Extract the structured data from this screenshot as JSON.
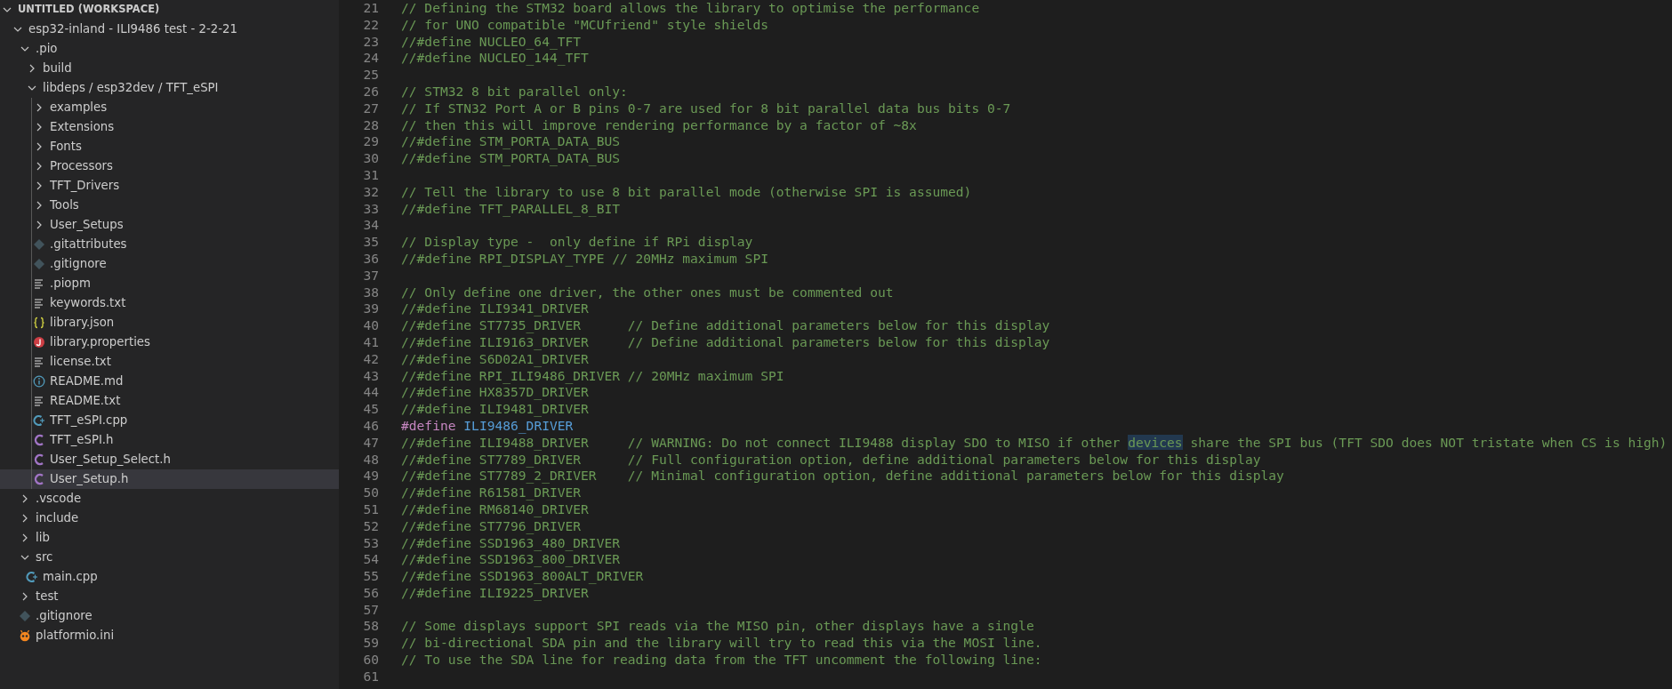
{
  "explorer": {
    "workspace": {
      "label": "UNTITLED (WORKSPACE)",
      "expanded": true
    },
    "tree": [
      {
        "label": "esp32-inland - ILI9486 test - 2-2-21",
        "kind": "folder",
        "expanded": true,
        "selected": false,
        "children": [
          {
            "label": ".pio",
            "kind": "folder",
            "expanded": true,
            "selected": false,
            "children": [
              {
                "label": "build",
                "kind": "folder",
                "expanded": false,
                "selected": false
              },
              {
                "label": "libdeps / esp32dev / TFT_eSPI",
                "kind": "folder",
                "expanded": true,
                "selected": false,
                "children": [
                  {
                    "label": "examples",
                    "kind": "folder",
                    "expanded": false,
                    "selected": false
                  },
                  {
                    "label": "Extensions",
                    "kind": "folder",
                    "expanded": false,
                    "selected": false
                  },
                  {
                    "label": "Fonts",
                    "kind": "folder",
                    "expanded": false,
                    "selected": false
                  },
                  {
                    "label": "Processors",
                    "kind": "folder",
                    "expanded": false,
                    "selected": false
                  },
                  {
                    "label": "TFT_Drivers",
                    "kind": "folder",
                    "expanded": false,
                    "selected": false
                  },
                  {
                    "label": "Tools",
                    "kind": "folder",
                    "expanded": false,
                    "selected": false
                  },
                  {
                    "label": "User_Setups",
                    "kind": "folder",
                    "expanded": false,
                    "selected": false
                  },
                  {
                    "label": ".gitattributes",
                    "kind": "git",
                    "selected": false
                  },
                  {
                    "label": ".gitignore",
                    "kind": "git",
                    "selected": false
                  },
                  {
                    "label": ".piopm",
                    "kind": "text",
                    "selected": false
                  },
                  {
                    "label": "keywords.txt",
                    "kind": "text",
                    "selected": false
                  },
                  {
                    "label": "library.json",
                    "kind": "json",
                    "selected": false
                  },
                  {
                    "label": "library.properties",
                    "kind": "properties",
                    "selected": false
                  },
                  {
                    "label": "license.txt",
                    "kind": "text",
                    "selected": false
                  },
                  {
                    "label": "README.md",
                    "kind": "info",
                    "selected": false
                  },
                  {
                    "label": "README.txt",
                    "kind": "text",
                    "selected": false
                  },
                  {
                    "label": "TFT_eSPI.cpp",
                    "kind": "cpp",
                    "selected": false
                  },
                  {
                    "label": "TFT_eSPI.h",
                    "kind": "c",
                    "selected": false
                  },
                  {
                    "label": "User_Setup_Select.h",
                    "kind": "c",
                    "selected": false
                  },
                  {
                    "label": "User_Setup.h",
                    "kind": "c",
                    "selected": true
                  }
                ]
              }
            ]
          },
          {
            "label": ".vscode",
            "kind": "folder",
            "expanded": false,
            "selected": false
          },
          {
            "label": "include",
            "kind": "folder",
            "expanded": false,
            "selected": false
          },
          {
            "label": "lib",
            "kind": "folder",
            "expanded": false,
            "selected": false
          },
          {
            "label": "src",
            "kind": "folder",
            "expanded": true,
            "selected": false,
            "children": [
              {
                "label": "main.cpp",
                "kind": "cpp",
                "selected": false
              }
            ]
          },
          {
            "label": "test",
            "kind": "folder",
            "expanded": false,
            "selected": false
          },
          {
            "label": ".gitignore",
            "kind": "git",
            "selected": false
          },
          {
            "label": "platformio.ini",
            "kind": "platformio",
            "selected": false
          }
        ]
      }
    ]
  },
  "editor": {
    "lines": [
      {
        "number": "21",
        "tokens": [
          {
            "kind": "comment",
            "text": "// Defining the STM32 board allows the library to optimise the performance"
          }
        ]
      },
      {
        "number": "22",
        "tokens": [
          {
            "kind": "comment",
            "text": "// for UNO compatible \"MCUfriend\" style shields"
          }
        ]
      },
      {
        "number": "23",
        "tokens": [
          {
            "kind": "comment",
            "text": "//#define NUCLEO_64_TFT"
          }
        ]
      },
      {
        "number": "24",
        "tokens": [
          {
            "kind": "comment",
            "text": "//#define NUCLEO_144_TFT"
          }
        ]
      },
      {
        "number": "25"
      },
      {
        "number": "26",
        "tokens": [
          {
            "kind": "comment",
            "text": "// STM32 8 bit parallel only:"
          }
        ]
      },
      {
        "number": "27",
        "tokens": [
          {
            "kind": "comment",
            "text": "// If STN32 Port A or B pins 0-7 are used for 8 bit parallel data bus bits 0-7"
          }
        ]
      },
      {
        "number": "28",
        "tokens": [
          {
            "kind": "comment",
            "text": "// then this will improve rendering performance by a factor of ~8x"
          }
        ]
      },
      {
        "number": "29",
        "tokens": [
          {
            "kind": "comment",
            "text": "//#define STM_PORTA_DATA_BUS"
          }
        ]
      },
      {
        "number": "30",
        "tokens": [
          {
            "kind": "comment",
            "text": "//#define STM_PORTA_DATA_BUS"
          }
        ]
      },
      {
        "number": "31"
      },
      {
        "number": "32",
        "tokens": [
          {
            "kind": "comment",
            "text": "// Tell the library to use 8 bit parallel mode (otherwise SPI is assumed)"
          }
        ]
      },
      {
        "number": "33",
        "tokens": [
          {
            "kind": "comment",
            "text": "//#define TFT_PARALLEL_8_BIT"
          }
        ]
      },
      {
        "number": "34"
      },
      {
        "number": "35",
        "tokens": [
          {
            "kind": "comment",
            "text": "// Display type -  only define if RPi display"
          }
        ]
      },
      {
        "number": "36",
        "tokens": [
          {
            "kind": "comment",
            "text": "//#define RPI_DISPLAY_TYPE // 20MHz maximum SPI"
          }
        ]
      },
      {
        "number": "37"
      },
      {
        "number": "38",
        "tokens": [
          {
            "kind": "comment",
            "text": "// Only define one driver, the other ones must be commented out"
          }
        ]
      },
      {
        "number": "39",
        "tokens": [
          {
            "kind": "comment",
            "text": "//#define ILI9341_DRIVER"
          }
        ]
      },
      {
        "number": "40",
        "tokens": [
          {
            "kind": "comment",
            "text": "//#define ST7735_DRIVER      // Define additional parameters below for this display"
          }
        ]
      },
      {
        "number": "41",
        "tokens": [
          {
            "kind": "comment",
            "text": "//#define ILI9163_DRIVER     // Define additional parameters below for this display"
          }
        ]
      },
      {
        "number": "42",
        "tokens": [
          {
            "kind": "comment",
            "text": "//#define S6D02A1_DRIVER"
          }
        ]
      },
      {
        "number": "43",
        "tokens": [
          {
            "kind": "comment",
            "text": "//#define RPI_ILI9486_DRIVER // 20MHz maximum SPI"
          }
        ]
      },
      {
        "number": "44",
        "tokens": [
          {
            "kind": "comment",
            "text": "//#define HX8357D_DRIVER"
          }
        ]
      },
      {
        "number": "45",
        "tokens": [
          {
            "kind": "comment",
            "text": "//#define ILI9481_DRIVER"
          }
        ]
      },
      {
        "number": "46",
        "tokens": [
          {
            "kind": "directive",
            "text": "#define"
          },
          {
            "kind": "macro",
            "text": "ILI9486_DRIVER"
          }
        ]
      },
      {
        "number": "47",
        "tokens": [
          {
            "kind": "comment",
            "text": "//#define ILI9488_DRIVER     // WARNING: Do not connect ILI9488 display SDO to MISO if other "
          },
          {
            "kind": "match",
            "text": "devices"
          },
          {
            "kind": "comment",
            "text": " share the SPI bus (TFT SDO does NOT tristate when CS is high)"
          }
        ]
      },
      {
        "number": "48",
        "tokens": [
          {
            "kind": "comment",
            "text": "//#define ST7789_DRIVER      // Full configuration option, define additional parameters below for this display"
          }
        ]
      },
      {
        "number": "49",
        "tokens": [
          {
            "kind": "comment",
            "text": "//#define ST7789_2_DRIVER    // Minimal configuration option, define additional parameters below for this display"
          }
        ]
      },
      {
        "number": "50",
        "tokens": [
          {
            "kind": "comment",
            "text": "//#define R61581_DRIVER"
          }
        ]
      },
      {
        "number": "51",
        "tokens": [
          {
            "kind": "comment",
            "text": "//#define RM68140_DRIVER"
          }
        ]
      },
      {
        "number": "52",
        "tokens": [
          {
            "kind": "comment",
            "text": "//#define ST7796_DRIVER"
          }
        ]
      },
      {
        "number": "53",
        "tokens": [
          {
            "kind": "comment",
            "text": "//#define SSD1963_480_DRIVER"
          }
        ]
      },
      {
        "number": "54",
        "tokens": [
          {
            "kind": "comment",
            "text": "//#define SSD1963_800_DRIVER"
          }
        ]
      },
      {
        "number": "55",
        "tokens": [
          {
            "kind": "comment",
            "text": "//#define SSD1963_800ALT_DRIVER"
          }
        ]
      },
      {
        "number": "56",
        "tokens": [
          {
            "kind": "comment",
            "text": "//#define ILI9225_DRIVER"
          }
        ]
      },
      {
        "number": "57"
      },
      {
        "number": "58",
        "tokens": [
          {
            "kind": "comment",
            "text": "// Some displays support SPI reads via the MISO pin, other displays have a single"
          }
        ]
      },
      {
        "number": "59",
        "tokens": [
          {
            "kind": "comment",
            "text": "// bi-directional SDA pin and the library will try to read this via the MOSI line."
          }
        ]
      },
      {
        "number": "60",
        "tokens": [
          {
            "kind": "comment",
            "text": "// To use the SDA line for reading data from the TFT uncomment the following line:"
          }
        ]
      },
      {
        "number": "61"
      }
    ]
  }
}
